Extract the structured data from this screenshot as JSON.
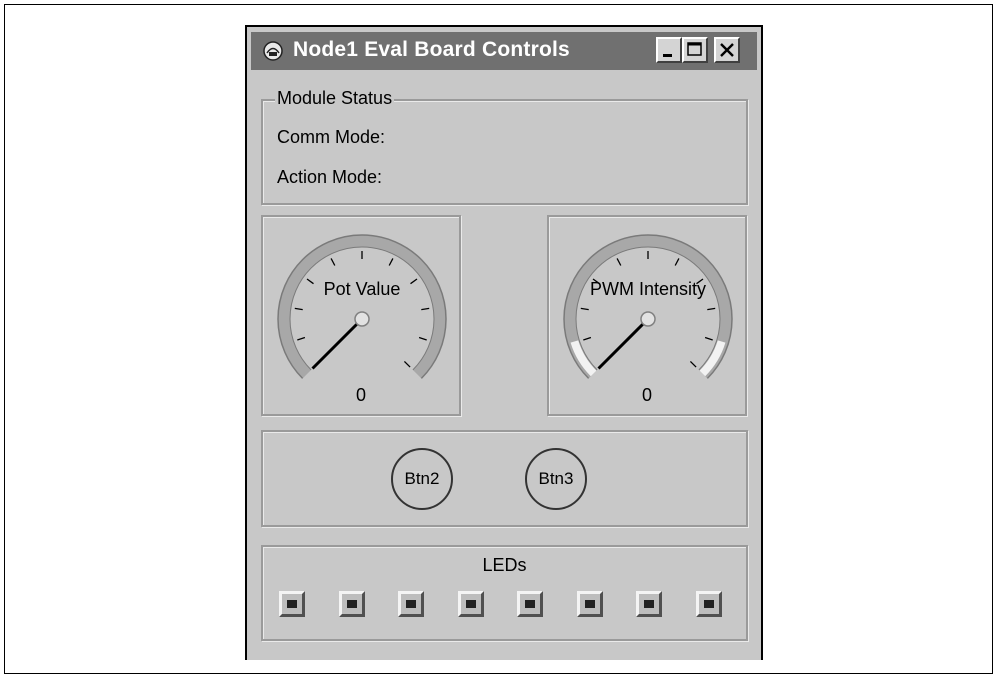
{
  "window": {
    "title": "Node1 Eval Board Controls",
    "controls": {
      "minimize": "minimize",
      "maximize": "maximize",
      "close": "close"
    }
  },
  "status": {
    "group_label": "Module Status",
    "comm_mode_label": "Comm Mode:",
    "action_mode_label": "Action Mode:"
  },
  "gauges": [
    {
      "label": "Pot Value",
      "value": "0",
      "level": 0
    },
    {
      "label": "PWM Intensity",
      "value": "0",
      "level": 0
    }
  ],
  "buttons": [
    {
      "label": "Btn2"
    },
    {
      "label": "Btn3"
    }
  ],
  "leds": {
    "title": "LEDs",
    "count": 8,
    "states": [
      false,
      false,
      false,
      false,
      false,
      false,
      false,
      false
    ]
  },
  "colors": {
    "title_bar": "#707070",
    "window_bg": "#c8c8c8",
    "gauge_arc": "#a8a8a8",
    "gauge_highlight": "#f2f2f2",
    "needle": "#000000"
  }
}
